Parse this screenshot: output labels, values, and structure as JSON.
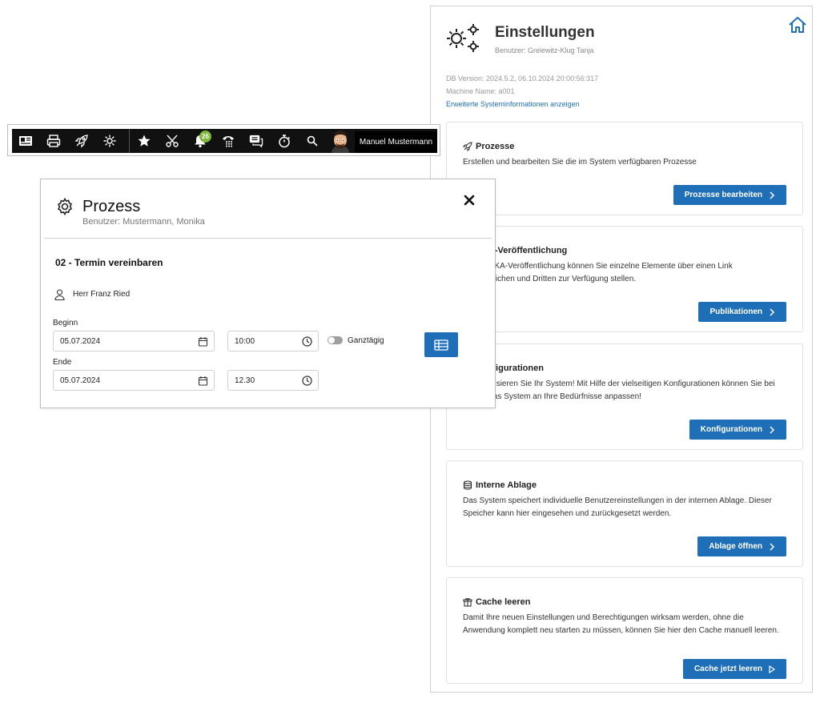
{
  "settings": {
    "title": "Einstellungen",
    "user": "Benutzer: Grelewitz-Klug Tanja",
    "db_version": "DB Version: 2024.5.2, 06.10.2024 20:00:56:317",
    "machine_name": "Machine Name: a001",
    "sysinfo_link": "Erweiterte Systeminformationen anzeigen",
    "cards": [
      {
        "icon": "rocket-icon",
        "title": "Prozesse",
        "desc": "Erstellen und bearbeiten Sie die im System verfügbaren Prozesse",
        "button": "Prozesse bearbeiten"
      },
      {
        "icon": "share-icon",
        "title": "AKA-Veröffentlichung",
        "desc": "Mit der AKA-Veröffentlichung können Sie einzelne Elemente über einen Link veröffentlichen und Dritten zur Verfügung stellen.",
        "button": "Publikationen"
      },
      {
        "icon": "sliders-icon",
        "title": "Konfigurationen",
        "desc": "Personalisieren Sie Ihr System! Mit Hilfe der vielseitigen Konfigurationen können Sie bei Bedarf das System an Ihre Bedürfnisse anpassen!",
        "button": "Konfigurationen"
      },
      {
        "icon": "database-icon",
        "title": "Interne Ablage",
        "desc": "Das System speichert individuelle Benutzereinstellungen in der internen Ablage. Dieser Speicher kann hier eingesehen und zurückgesetzt werden.",
        "button": "Ablage öffnen"
      },
      {
        "icon": "box-icon",
        "title": "Cache leeren",
        "desc": "Damit Ihre neuen Einstellungen und Berechtigungen wirksam werden, ohne die Anwendung komplett neu starten zu müssen, können Sie hier den Cache manuell leeren.",
        "button": "Cache jetzt leeren"
      }
    ]
  },
  "toolbar": {
    "icons": [
      "newspaper-icon",
      "printer-icon",
      "rocket-icon",
      "gear-icon",
      "star-icon",
      "scissors-icon",
      "bell-icon",
      "phone-keypad-icon",
      "chat-icon",
      "stopwatch-icon",
      "search-icon"
    ],
    "notification_count": "26",
    "user_name": "Manuel Mustermann",
    "colors": {
      "background": "#111111",
      "badge": "#7cb93d"
    }
  },
  "process": {
    "title": "Prozess",
    "user": "Benutzer: Mustermann, Monika",
    "subtitle": "02 - Termin vereinbaren",
    "person": "Herr Franz Ried",
    "begin_label": "Beginn",
    "begin_date": "05.07.2024",
    "begin_time": "10:00",
    "end_label": "Ende",
    "end_date": "05.07.2024",
    "end_time": "12.30",
    "all_day_label": "Ganztägig",
    "all_day": false
  },
  "colors": {
    "accent": "#1f6fb8",
    "border": "#cfcfcf"
  }
}
